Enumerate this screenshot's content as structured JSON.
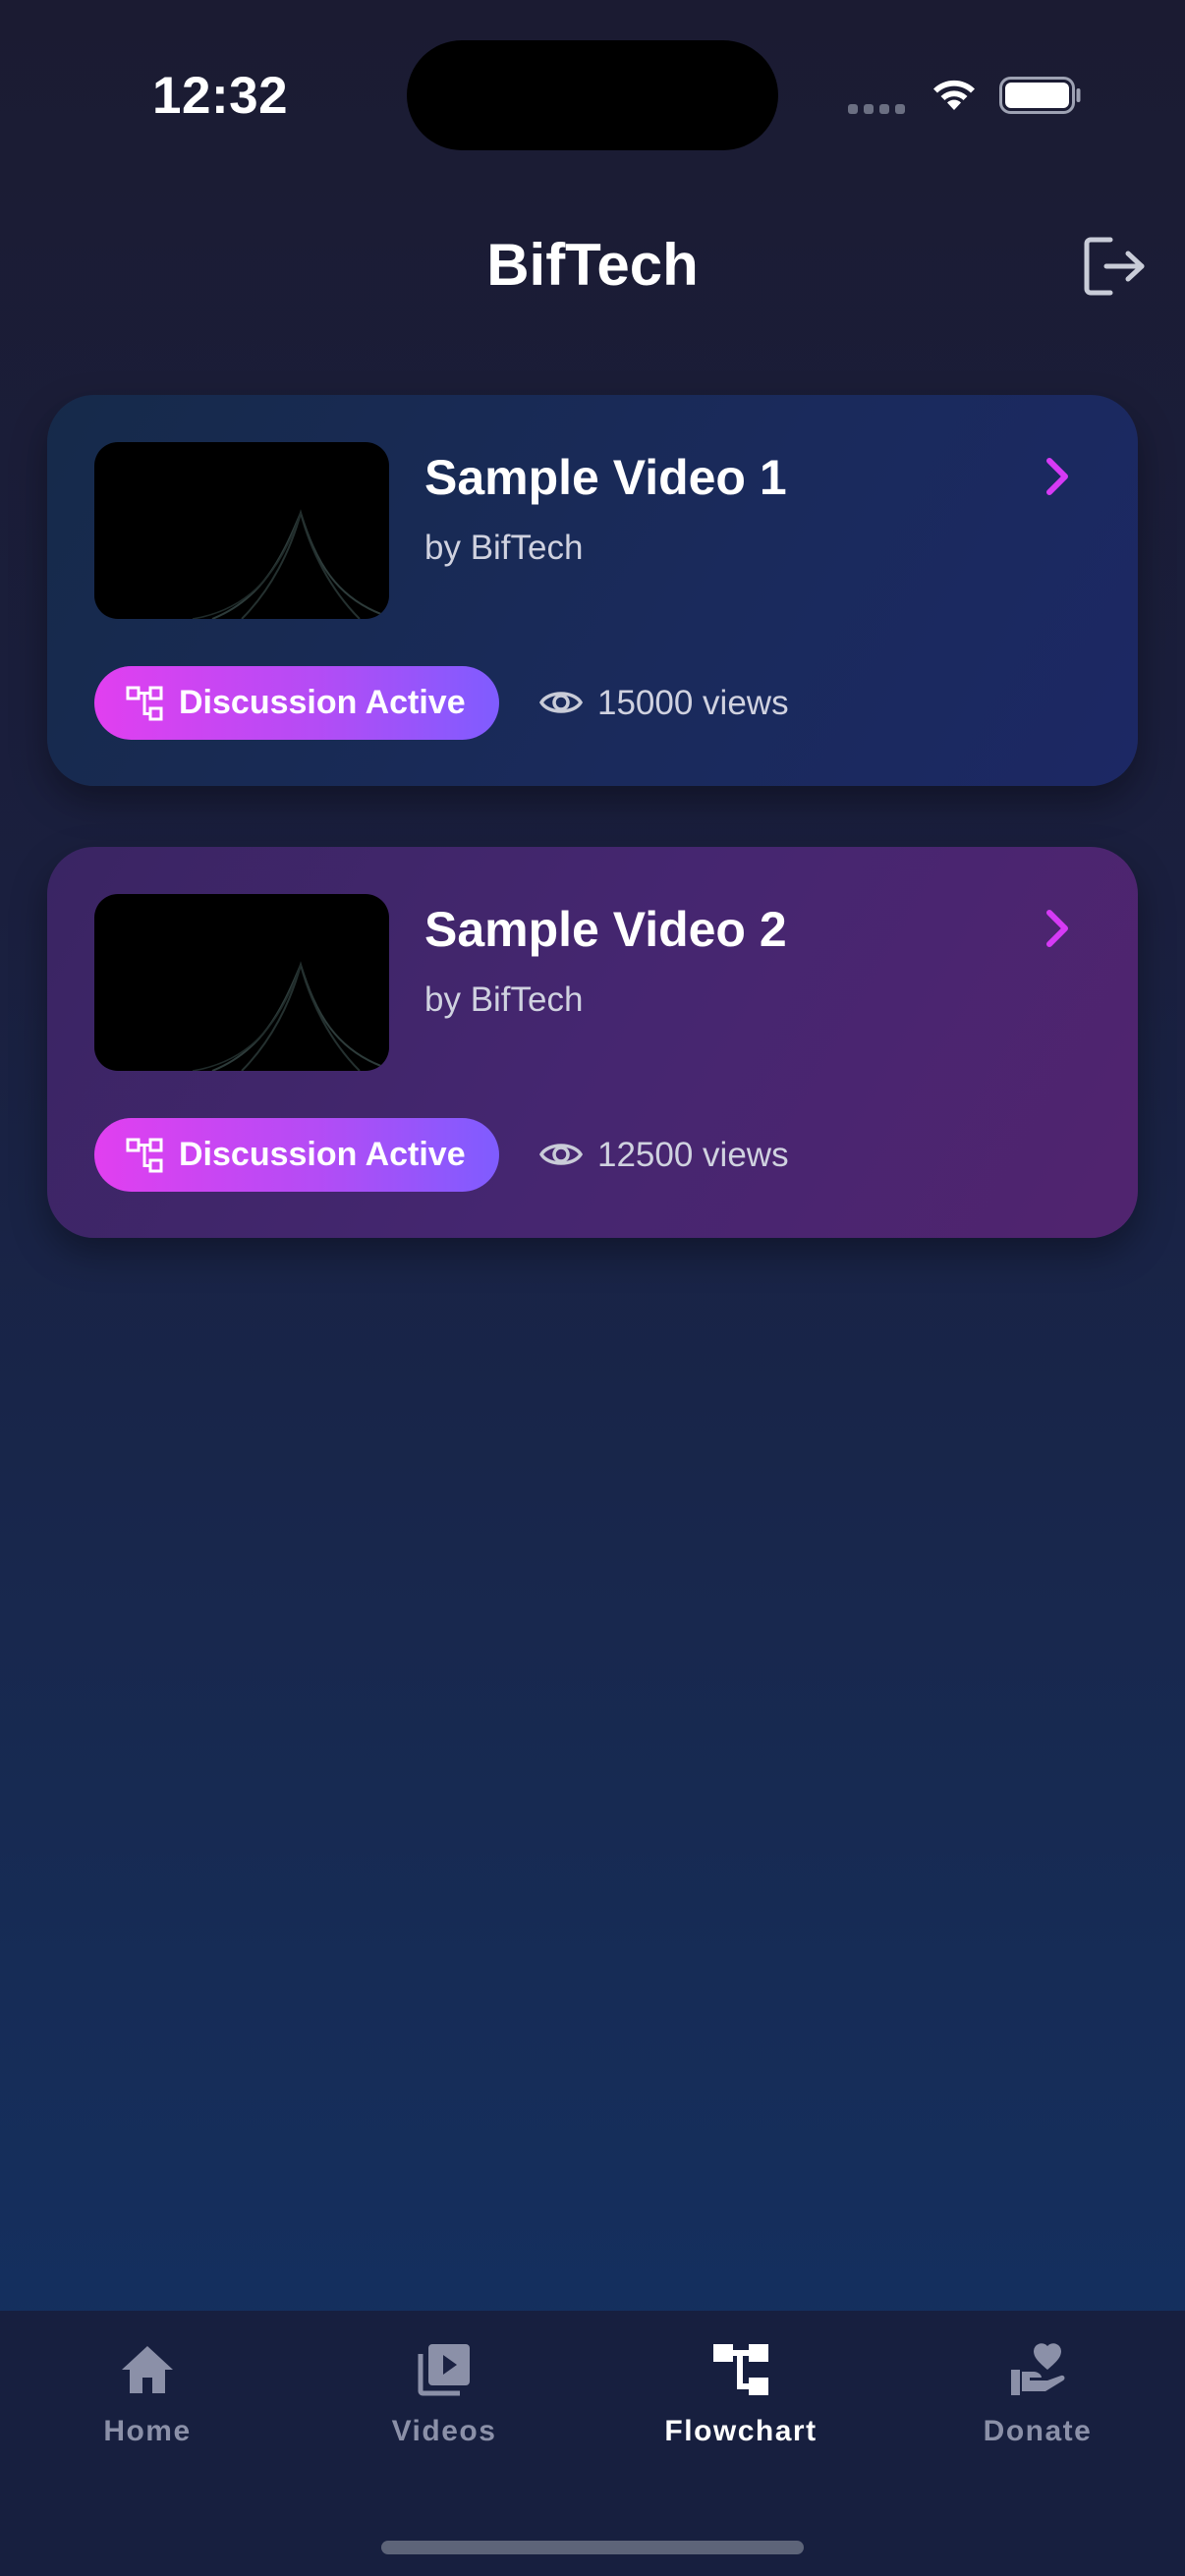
{
  "status_bar": {
    "time": "12:32"
  },
  "header": {
    "title": "BifTech",
    "logout_icon": "logout-icon"
  },
  "videos": [
    {
      "title": "Sample Video 1",
      "author": "by BifTech",
      "badge": "Discussion Active",
      "views": "15000 views"
    },
    {
      "title": "Sample Video 2",
      "author": "by BifTech",
      "badge": "Discussion Active",
      "views": "12500 views"
    }
  ],
  "tabs": [
    {
      "label": "Home",
      "icon": "home-icon",
      "active": false
    },
    {
      "label": "Videos",
      "icon": "video-library-icon",
      "active": false
    },
    {
      "label": "Flowchart",
      "icon": "flowchart-icon",
      "active": true
    },
    {
      "label": "Donate",
      "icon": "donate-icon",
      "active": false
    }
  ],
  "colors": {
    "accent": "#d63af5",
    "badge_gradient_start": "#e13ff0",
    "badge_gradient_end": "#7f5cff",
    "tab_active": "#ffffff",
    "tab_inactive": "#8b90a8"
  }
}
